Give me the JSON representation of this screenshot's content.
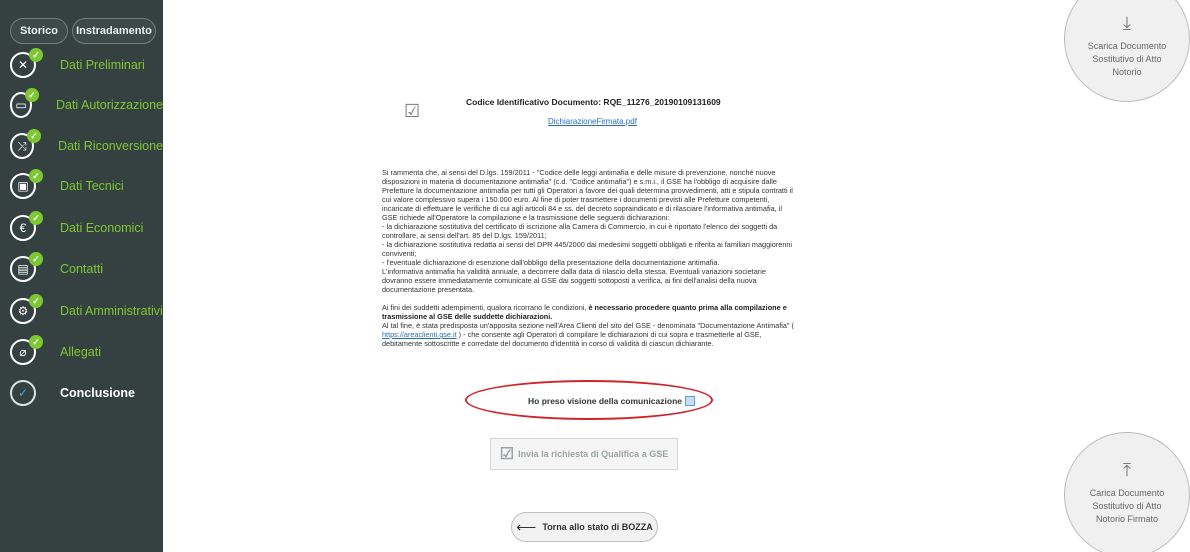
{
  "sidebar": {
    "tabs": [
      {
        "label": "Storico"
      },
      {
        "label": "Instradamento"
      }
    ],
    "items": [
      {
        "label": "Dati Preliminari",
        "icon": "✕"
      },
      {
        "label": "Dati Autorizzazione",
        "icon": "▭"
      },
      {
        "label": "Dati Riconversione",
        "icon": "⤨"
      },
      {
        "label": "Dati Tecnici",
        "icon": "▣"
      },
      {
        "label": "Dati Economici",
        "icon": "€"
      },
      {
        "label": "Contatti",
        "icon": "▤"
      },
      {
        "label": "Dati Amministrativi",
        "icon": "⚙"
      },
      {
        "label": "Allegati",
        "icon": "⌀"
      },
      {
        "label": "Conclusione",
        "icon": "✓"
      }
    ],
    "check_glyph": "✓"
  },
  "document": {
    "code": "Codice Identificativo Documento: RQE_11276_20190109131609",
    "file_link": "DichiarazioneFirmata.pdf",
    "check_glyph": "☑"
  },
  "notice": {
    "para1": "Si rammenta che, ai sensi del D.lgs. 159/2011 - \"Codice delle leggi antimafia e delle misure di prevenzione, nonché nuove disposizioni in materia di documentazione antimafia\" (c.d. \"Codice antimafia\") e s.m.i., il GSE ha l'obbligo di acquisire dalle Prefetture la documentazione antimafia per tutti gli Operatori a favore dei quali determina provvedimenti, atti e stipula contratti il cui valore complessivo supera i 150.000 euro. Al fine di poter trasmettere i documenti previsti alle Prefetture competenti, incaricate di effettuare le verifiche di cui agli articoli 84 e ss. del decreto sopraindicato e di rilasciare l'informativa antimafia, il GSE richiede all'Operatore la compilazione e la trasmissione delle seguenti dichiarazioni:",
    "item1": "- la dichiarazione sostitutiva del certificato di iscrizione alla Camera di Commercio, in cui è riportato l'elenco dei soggetti da controllare, ai sensi dell'art. 85 del D.lgs. 159/2011;",
    "item2": "- la dichiarazione sostitutiva redatta ai sensi del DPR 445/2000 dai medesimi soggetti obbligati e riferita ai familiari maggiorenni conviventi;",
    "item3": "- l'eventuale dichiarazione di esenzione dall'obbligo della presentazione della documentazione antimafia.",
    "para2": "L'informativa antimafia ha validità annuale, a decorrere dalla data di rilascio della stessa. Eventuali variazioni societarie dovranno essere immediatamente comunicate al GSE dai soggetti sottoposti a verifica, ai fini dell'analisi della nuova documentazione presentata.",
    "para3_start": "Ai fini dei suddetti adempimenti, qualora ricorrano le condizioni, ",
    "para3_bold": "è necessario procedere quanto prima alla compilazione e trasmissione al GSE delle suddette dichiarazioni.",
    "para4_start": "Al tal fine, è stata predisposta un'apposita sezione nell'Area Clienti del sito del GSE - denominata \"Documentazione Antimafia\" ( ",
    "para4_link": "https://areaclienti.gse.it",
    "para4_end": " ) - che consente agli Operatori di compilare le dichiarazioni di cui sopra e trasmetterle al GSE, debitamente sottoscritte e corredate del documento d'identità in corso di validità di ciascun dichiarante."
  },
  "ack_label": "Ho preso visione della comunicazione",
  "send_button": {
    "label": "Invia la richiesta di Qualifica a GSE",
    "icon": "☑"
  },
  "back_button": {
    "label": "Torna allo stato di BOZZA",
    "icon": "⟵"
  },
  "download_circle": {
    "icon": "⤓",
    "line1": "Scarica Documento",
    "line2": "Sostitutivo di Atto",
    "line3": "Notorio"
  },
  "upload_circle": {
    "icon": "⤒",
    "line1": "Carica Documento",
    "line2": "Sostitutivo di Atto",
    "line3": "Notorio Firmato"
  },
  "colors": {
    "sidebar_bg": "#354040",
    "nav_green": "#7dc832",
    "link_blue": "#2a6fb7",
    "highlight_red": "#d0232a"
  }
}
